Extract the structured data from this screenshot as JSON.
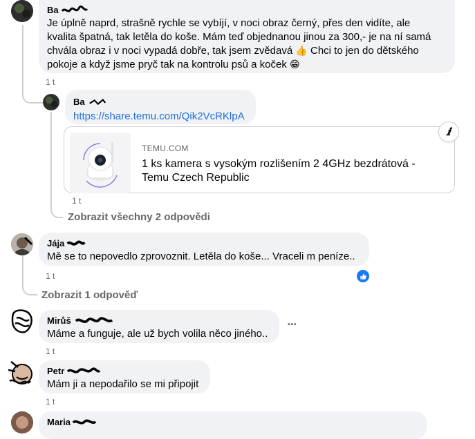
{
  "comments": [
    {
      "author": "Ba",
      "text_line1": "Je úplně naprd, strašně rychle se vybíjí, v noci obraz černý, přes den vidíte, ale",
      "text_line2": "kvalita špatná, tak letěla do koše. Mám teď objednanou jinou za 300,- je na ní samá",
      "text_line3": "chvála obraz i v noci vypadá dobře, tak jsem zvědavá",
      "emoji1": "👍",
      "text_line4": "Chci to jen do dětského",
      "text_line5": "pokoje a když jsme pryč tak na kontrolu psů a koček",
      "emoji2": "😁",
      "time": "1 t"
    },
    {
      "author": "Ba",
      "link": "https://share.temu.com/Qik2VcRKlpA",
      "card_domain": "TEMU.COM",
      "card_title": "1 ks kamera s vysokým rozlišením 2 4GHz bezdrátová - Temu Czech Republic",
      "info_icon": "ⅈ",
      "time": "1 t"
    },
    {
      "author": "Jája",
      "text": "Mě se to nepovedlo zprovoznit. Letěla do koše... Vraceli m peníze..",
      "time": "1 t",
      "reaction": "like"
    },
    {
      "author": "Mirůš",
      "text": "Máme a funguje, ale už bych volila něco jiného..",
      "time": "1 t",
      "more": "•••"
    },
    {
      "author": "Petr",
      "text": "Mám ji a nepodařilo se mi připojit",
      "time": "1 t"
    },
    {
      "author": "Maria"
    }
  ],
  "view_replies_1": "Zobrazit všechny 2 odpovědi",
  "view_replies_2": "Zobrazit 1 odpověď",
  "colors": {
    "bubble": "#f0f2f5",
    "link": "#216fdb",
    "meta": "#65676b",
    "like": "#1877f2"
  }
}
